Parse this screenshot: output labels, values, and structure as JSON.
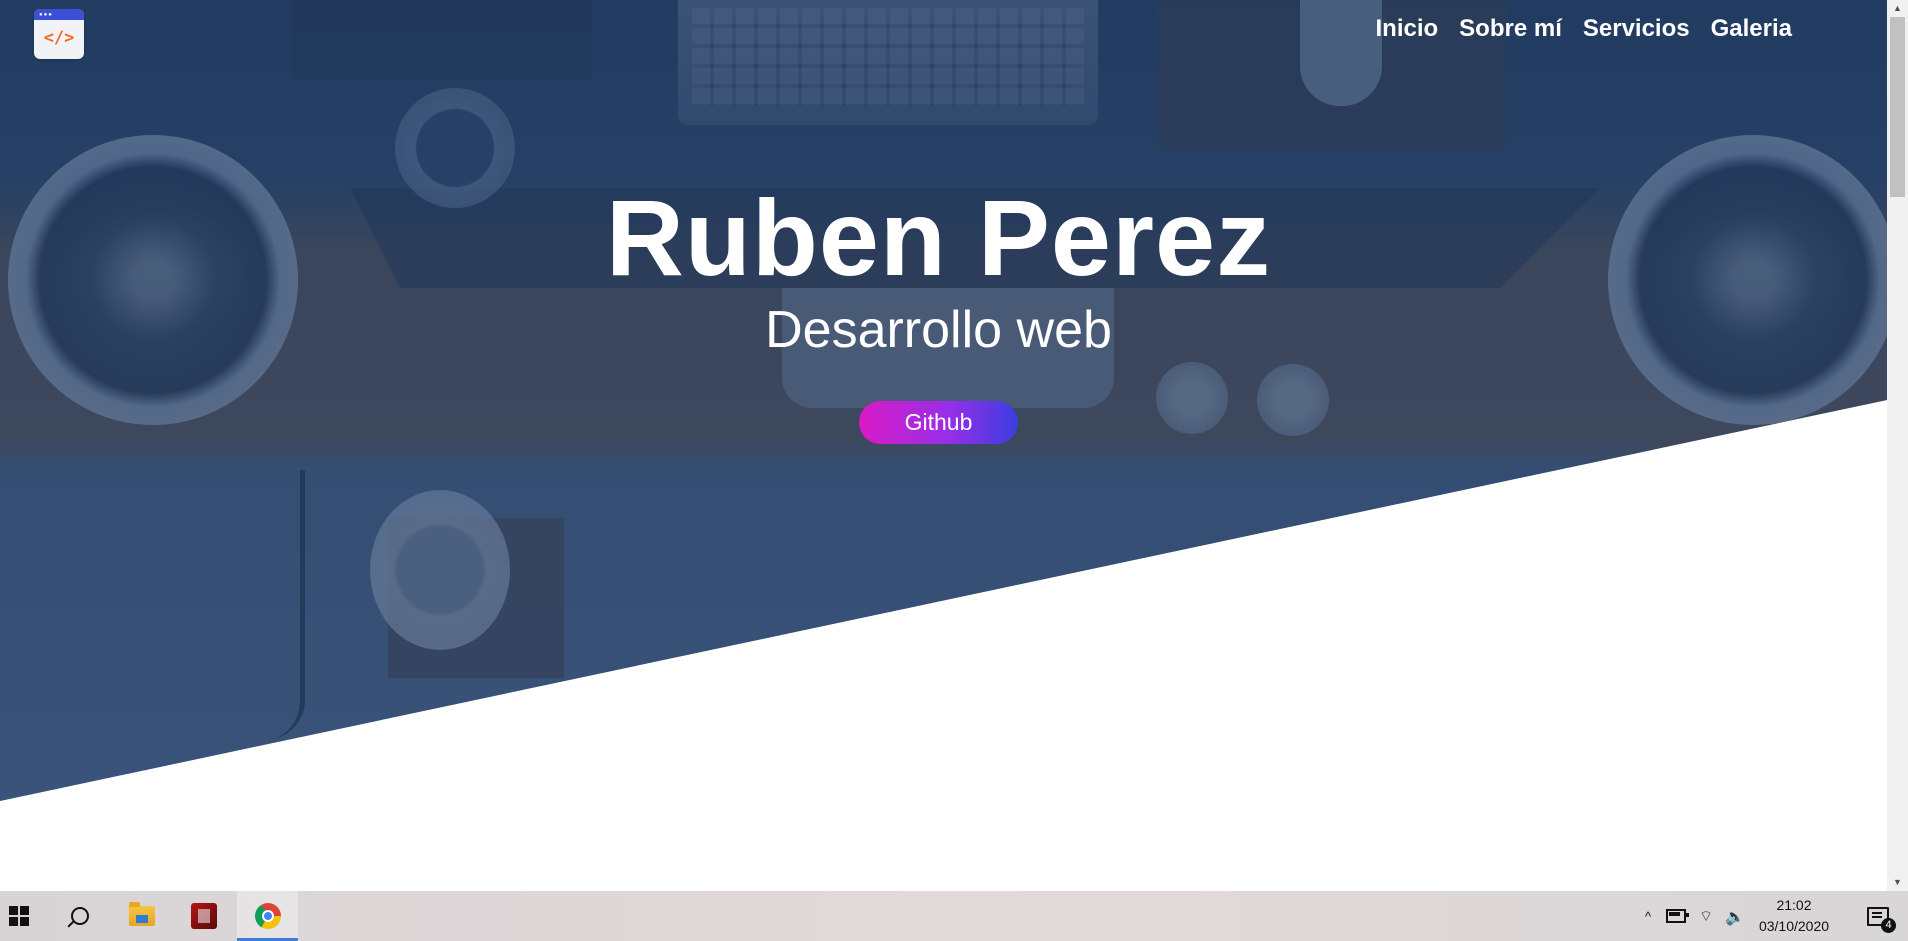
{
  "header": {
    "logo_icon": "code-brackets-icon",
    "logo_text": "</>",
    "nav": [
      {
        "label": "Inicio"
      },
      {
        "label": "Sobre mí"
      },
      {
        "label": "Servicios"
      },
      {
        "label": "Galeria"
      }
    ]
  },
  "hero": {
    "title": "Ruben Perez",
    "subtitle": "Desarrollo web",
    "button_label": "Github",
    "button_colors": [
      "#d91ac4",
      "#3a3ee0"
    ],
    "overlay_color": "#24426e"
  },
  "taskbar": {
    "start_icon": "windows-icon",
    "search_icon": "search-icon",
    "pinned_apps": [
      "file-explorer-icon",
      "red-app-icon",
      "chrome-icon"
    ],
    "active_app": "chrome-icon",
    "tray": {
      "chevron": "^",
      "network_glyph": "⌔",
      "volume_glyph": "🔈",
      "time": "21:02",
      "date": "03/10/2020",
      "notification_count": "4"
    }
  }
}
